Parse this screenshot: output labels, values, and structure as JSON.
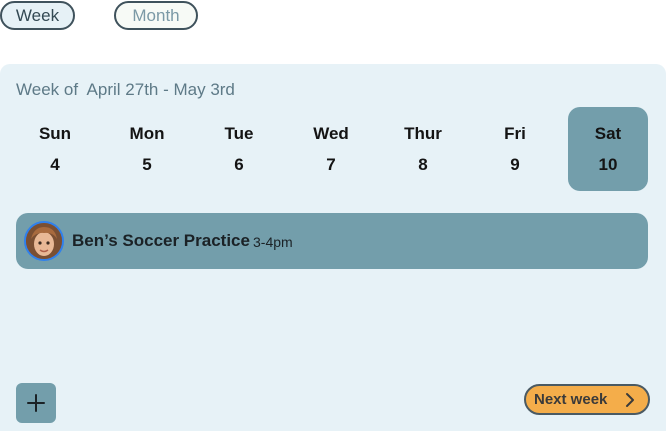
{
  "view_toggle": {
    "week_label": "Week",
    "month_label": "Month",
    "active": "Week"
  },
  "calendar": {
    "week_title": "Week of  April 27th - May 3rd",
    "days": [
      {
        "name": "Sun",
        "num": "4"
      },
      {
        "name": "Mon",
        "num": "5"
      },
      {
        "name": "Tue",
        "num": "6"
      },
      {
        "name": "Wed",
        "num": "7"
      },
      {
        "name": "Thur",
        "num": "8"
      },
      {
        "name": "Fri",
        "num": "9"
      },
      {
        "name": "Sat",
        "num": "10"
      }
    ],
    "selected_day": "Sat"
  },
  "event": {
    "title": "Ben’s Soccer Practice",
    "time": "3-4pm",
    "avatar_icon": "child-avatar"
  },
  "actions": {
    "add_icon": "plus-icon",
    "next_label": "Next week",
    "next_icon": "chevron-right-icon"
  },
  "colors": {
    "panel_bg": "#e7f2f7",
    "accent": "#739eab",
    "next_button": "#f4ad4a"
  }
}
